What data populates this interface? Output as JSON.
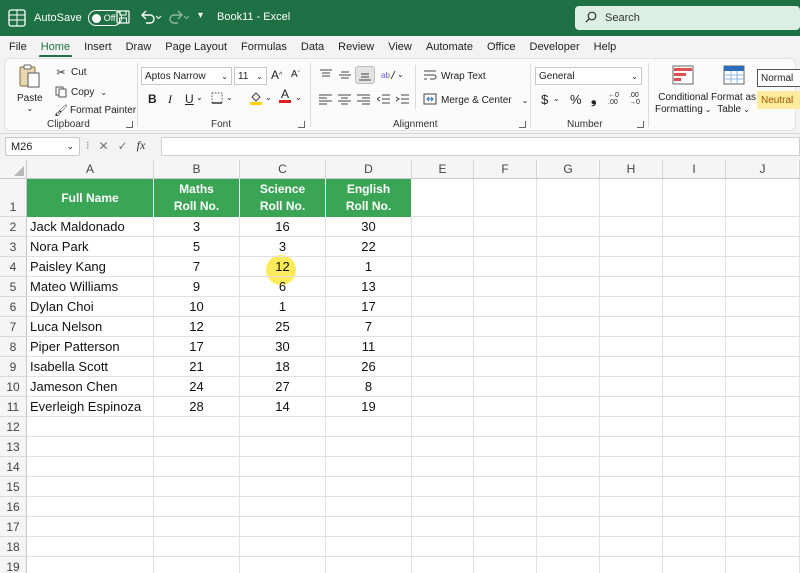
{
  "titlebar": {
    "autosave_label": "AutoSave",
    "autosave_state": "Off",
    "doc_title": "Book11  -  Excel",
    "search_placeholder": "Search"
  },
  "menu_tabs": [
    "File",
    "Home",
    "Insert",
    "Draw",
    "Page Layout",
    "Formulas",
    "Data",
    "Review",
    "View",
    "Automate",
    "Office",
    "Developer",
    "Help"
  ],
  "ribbon": {
    "clipboard": {
      "paste": "Paste",
      "cut": "Cut",
      "copy": "Copy",
      "format_painter": "Format Painter",
      "label": "Clipboard"
    },
    "font": {
      "family": "Aptos Narrow",
      "size": "11",
      "label": "Font"
    },
    "alignment": {
      "wrap_text": "Wrap Text",
      "merge_center": "Merge & Center",
      "label": "Alignment"
    },
    "number": {
      "format": "General",
      "label": "Number"
    },
    "styles": {
      "conditional_1": "Conditional",
      "conditional_2": "Formatting",
      "format_table_1": "Format as",
      "format_table_2": "Table",
      "style_normal": "Normal",
      "style_neutral": "Neutral"
    }
  },
  "formula_bar": {
    "name_box": "M26",
    "fx": "fx",
    "formula": ""
  },
  "columns": [
    "A",
    "B",
    "C",
    "D",
    "E",
    "F",
    "G",
    "H",
    "I",
    "J"
  ],
  "rows": [
    "1",
    "2",
    "3",
    "4",
    "5",
    "6",
    "7",
    "8",
    "9",
    "10",
    "11",
    "12",
    "13",
    "14",
    "15",
    "16",
    "17",
    "18",
    "19"
  ],
  "table": {
    "headers": {
      "full_name": "Full Name",
      "maths_1": "Maths",
      "maths_2": "Roll No.",
      "science_1": "Science",
      "science_2": "Roll No.",
      "english_1": "English",
      "english_2": "Roll No."
    },
    "records": [
      {
        "name": "Jack Maldonado",
        "maths": "3",
        "science": "16",
        "english": "30"
      },
      {
        "name": "Nora Park",
        "maths": "5",
        "science": "3",
        "english": "22"
      },
      {
        "name": "Paisley Kang",
        "maths": "7",
        "science": "12",
        "english": "1"
      },
      {
        "name": "Mateo Williams",
        "maths": "9",
        "science": "6",
        "english": "13"
      },
      {
        "name": "Dylan Choi",
        "maths": "10",
        "science": "1",
        "english": "17"
      },
      {
        "name": "Luca Nelson",
        "maths": "12",
        "science": "25",
        "english": "7"
      },
      {
        "name": "Piper Patterson",
        "maths": "17",
        "science": "30",
        "english": "11"
      },
      {
        "name": "Isabella Scott",
        "maths": "21",
        "science": "18",
        "english": "26"
      },
      {
        "name": "Jameson Chen",
        "maths": "24",
        "science": "27",
        "english": "8"
      },
      {
        "name": "Everleigh Espinoza",
        "maths": "28",
        "science": "14",
        "english": "19"
      }
    ]
  },
  "colors": {
    "title_bar": "#1e7145",
    "header_fill": "#3aa655",
    "cursor_highlight": "#ffe83c",
    "neutral_style": "#ffeb9c"
  }
}
